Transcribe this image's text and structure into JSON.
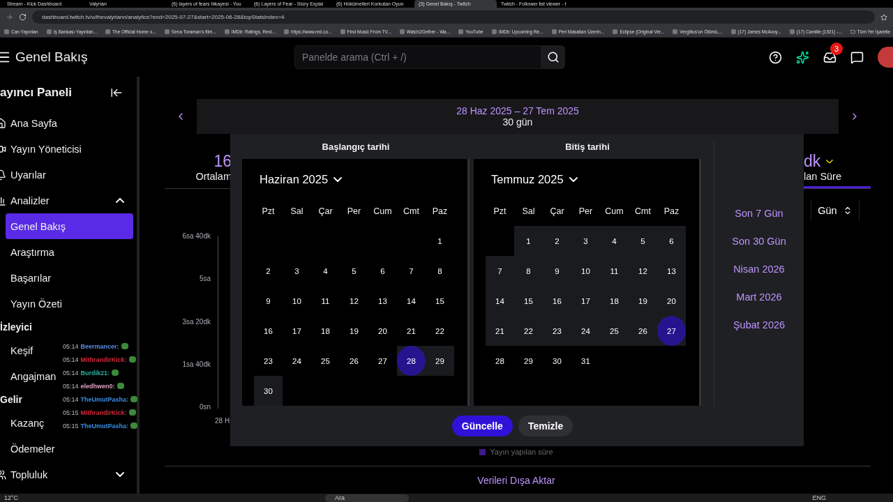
{
  "browser": {
    "tabs": [
      {
        "title": "Stream - Kick Dashboard",
        "selected": false
      },
      {
        "title": "Valyrian",
        "selected": false
      },
      {
        "title": "(6) layers of fears hikayesi - You",
        "selected": false
      },
      {
        "title": "(6) Layers of Fear - Story Explai",
        "selected": false
      },
      {
        "title": "(6) Hükümetleri Korkutan Oyun",
        "selected": false
      },
      {
        "title": "(3) Genel Bakış - Twitch",
        "selected": true
      },
      {
        "title": "Twitch - Follower list viewer - t",
        "selected": false
      }
    ],
    "url": "dashboard.twitch.tv/u/thevalyriann/analytics?end=2025-07-27&start=2025-06-28&topStatsIndex=4",
    "bookmarks": [
      "Can Yayınları",
      "İş Bankası Yayınlan...",
      "The Official Home o...",
      "Sena Toraman's film...",
      "IMDb: Ratings, Revi...",
      "https://www.red.co...",
      "Find Music From TV...",
      "Watch2Gether - Wa...",
      "YouTube",
      "IMDb: Upcoming Re...",
      "Peri Masalları Üzerin...",
      "Eclipse (Original Ver...",
      "Vergilius'un Ölümü,...",
      "(17) James McAvoy...",
      "(17) Camille (1921) -...",
      "Tüm Yer İşaretle"
    ]
  },
  "header": {
    "title": "Genel Bakış",
    "search": {
      "placeholder": "Panelde arama (Ctrl + /)"
    },
    "notification_count": "3"
  },
  "sidebar": {
    "title": "ayıncı Paneli",
    "items": [
      {
        "kind": "link",
        "label": "Ana Sayfa"
      },
      {
        "kind": "link",
        "label": "Yayın Yöneticisi"
      },
      {
        "kind": "link",
        "label": "Uyarılar"
      },
      {
        "kind": "group",
        "label": "Analizler",
        "expanded": true,
        "children": [
          {
            "label": "Genel Bakış",
            "selected": true
          },
          {
            "label": "Araştırma",
            "selected": false
          },
          {
            "label": "Başarılar",
            "selected": false
          },
          {
            "label": "Yayın Özeti",
            "selected": false
          }
        ]
      },
      {
        "kind": "section",
        "label": "İzleyici",
        "children": [
          {
            "label": "Keşif",
            "selected": false
          },
          {
            "label": "Angajman",
            "selected": false
          }
        ]
      },
      {
        "kind": "section",
        "label": "Gelir",
        "children": [
          {
            "label": "Kazanç",
            "selected": false
          },
          {
            "label": "Ödemeler",
            "selected": false
          }
        ]
      },
      {
        "kind": "group",
        "label": "Topluluk",
        "expanded": false
      }
    ]
  },
  "chat_overlay": [
    {
      "time": "05:14",
      "user": "Beermancer:",
      "color": "#5b8de6"
    },
    {
      "time": "05:14",
      "user": "MithrandirKick:",
      "color": "#d8263a"
    },
    {
      "time": "05:14",
      "user": "Burdik21:",
      "color": "#2bb0a0"
    },
    {
      "time": "05:14",
      "user": "eledhwen0:",
      "color": "#e0a0c0"
    },
    {
      "time": "05:14",
      "user": "TheUmutPasha:",
      "color": "#3a8de0"
    },
    {
      "time": "05:15",
      "user": "MithrandirKick:",
      "color": "#d8263a"
    },
    {
      "time": "05:15",
      "user": "TheUmutPasha:",
      "color": "#3a8de0"
    }
  ],
  "date_range": {
    "label": "28 Haz 2025 – 27 Tem 2025",
    "days": "30 gün"
  },
  "stats": [
    {
      "value": "16",
      "label": "Ortalam",
      "selected": false
    },
    {
      "value": "dk",
      "label": "lan Süre",
      "selected": true
    }
  ],
  "chart": {
    "y_labels": [
      "6sa 40dk",
      "5sa",
      "3sa 20dk",
      "1sa 40dk",
      "0sn"
    ],
    "x_label": "28 H",
    "interval": "Gün",
    "legend": "Yayın yapılan süre"
  },
  "date_picker": {
    "calendars": [
      {
        "heading": "Başlangıç tarihi",
        "month": "Haziran 2025",
        "weekdays": [
          "Pzt",
          "Sal",
          "Çar",
          "Per",
          "Cum",
          "Cmt",
          "Paz"
        ],
        "weeks": [
          {
            "days": [
              {
                "d": "1",
                "selected": false,
                "in_range": false
              }
            ]
          },
          [
            {
              "d": "2",
              "selected": false,
              "in_range": false
            },
            {
              "d": "3",
              "selected": false,
              "in_range": false
            },
            {
              "d": "4",
              "selected": false,
              "in_range": false
            },
            {
              "d": "5",
              "selected": false,
              "in_range": false
            },
            {
              "d": "6",
              "selected": false,
              "in_range": false
            },
            {
              "d": "7",
              "selected": false,
              "in_range": false
            },
            {
              "d": "8",
              "selected": false,
              "in_range": false
            }
          ],
          [
            {
              "d": "9",
              "selected": false,
              "in_range": false
            },
            {
              "d": "10",
              "selected": false,
              "in_range": false
            },
            {
              "d": "11",
              "selected": false,
              "in_range": false
            },
            {
              "d": "12",
              "selected": false,
              "in_range": false
            },
            {
              "d": "13",
              "selected": false,
              "in_range": false
            },
            {
              "d": "14",
              "selected": false,
              "in_range": false
            },
            {
              "d": "15",
              "selected": false,
              "in_range": false
            }
          ],
          [
            {
              "d": "16",
              "selected": false,
              "in_range": false
            },
            {
              "d": "17",
              "selected": false,
              "in_range": false
            },
            {
              "d": "18",
              "selected": false,
              "in_range": false
            },
            {
              "d": "19",
              "selected": false,
              "in_range": false
            },
            {
              "d": "20",
              "selected": false,
              "in_range": false
            },
            {
              "d": "21",
              "selected": false,
              "in_range": false
            },
            {
              "d": "22",
              "selected": false,
              "in_range": false
            }
          ],
          [
            {
              "d": "23",
              "selected": false,
              "in_range": false
            },
            {
              "d": "24",
              "selected": false,
              "in_range": false
            },
            {
              "d": "25",
              "selected": false,
              "in_range": false
            },
            {
              "d": "26",
              "selected": false,
              "in_range": false
            },
            {
              "d": "27",
              "selected": false,
              "in_range": false
            },
            {
              "d": "28",
              "selected": true,
              "in_range": true
            },
            {
              "d": "29",
              "selected": false,
              "in_range": true
            }
          ],
          {
            "days": [
              {
                "d": "30",
                "selected": false,
                "in_range": true
              }
            ]
          }
        ]
      },
      {
        "heading": "Bitiş tarihi",
        "month": "Temmuz 2025",
        "weekdays": [
          "Pzt",
          "Sal",
          "Çar",
          "Per",
          "Cum",
          "Cmt",
          "Paz"
        ],
        "weeks": [
          {
            "days": [
              {
                "d": "1",
                "selected": false,
                "in_range": true
              },
              {
                "d": "2",
                "selected": false,
                "in_range": true
              },
              {
                "d": "3",
                "selected": false,
                "in_range": true
              },
              {
                "d": "4",
                "selected": false,
                "in_range": true
              },
              {
                "d": "5",
                "selected": false,
                "in_range": true
              },
              {
                "d": "6",
                "selected": false,
                "in_range": true
              }
            ]
          },
          [
            {
              "d": "7",
              "selected": false,
              "in_range": true
            },
            {
              "d": "8",
              "selected": false,
              "in_range": true
            },
            {
              "d": "9",
              "selected": false,
              "in_range": true
            },
            {
              "d": "10",
              "selected": false,
              "in_range": true
            },
            {
              "d": "11",
              "selected": false,
              "in_range": true
            },
            {
              "d": "12",
              "selected": false,
              "in_range": true
            },
            {
              "d": "13",
              "selected": false,
              "in_range": true
            }
          ],
          [
            {
              "d": "14",
              "selected": false,
              "in_range": true
            },
            {
              "d": "15",
              "selected": false,
              "in_range": true
            },
            {
              "d": "16",
              "selected": false,
              "in_range": true
            },
            {
              "d": "17",
              "selected": false,
              "in_range": true
            },
            {
              "d": "18",
              "selected": false,
              "in_range": true
            },
            {
              "d": "19",
              "selected": false,
              "in_range": true
            },
            {
              "d": "20",
              "selected": false,
              "in_range": true
            }
          ],
          [
            {
              "d": "21",
              "selected": false,
              "in_range": true
            },
            {
              "d": "22",
              "selected": false,
              "in_range": true
            },
            {
              "d": "23",
              "selected": false,
              "in_range": true
            },
            {
              "d": "24",
              "selected": false,
              "in_range": true
            },
            {
              "d": "25",
              "selected": false,
              "in_range": true
            },
            {
              "d": "26",
              "selected": false,
              "in_range": true
            },
            {
              "d": "27",
              "selected": true,
              "in_range": true
            }
          ],
          {
            "days": [
              {
                "d": "28",
                "selected": false,
                "in_range": false
              },
              {
                "d": "29",
                "selected": false,
                "in_range": false
              },
              {
                "d": "30",
                "selected": false,
                "in_range": false
              },
              {
                "d": "31",
                "selected": false,
                "in_range": false
              }
            ]
          }
        ]
      }
    ],
    "presets": [
      "Son 7 Gün",
      "Son 30 Gün",
      "Nisan 2026",
      "Mart 2026",
      "Şubat 2026"
    ],
    "buttons": [
      {
        "label": "Güncelle",
        "kind": "primary"
      },
      {
        "label": "Temizle",
        "kind": "secondary"
      }
    ]
  },
  "export_link": "Verileri Dışa Aktar",
  "taskbar": {
    "weather": "12°C",
    "search": "Ara",
    "language": "ENG"
  }
}
